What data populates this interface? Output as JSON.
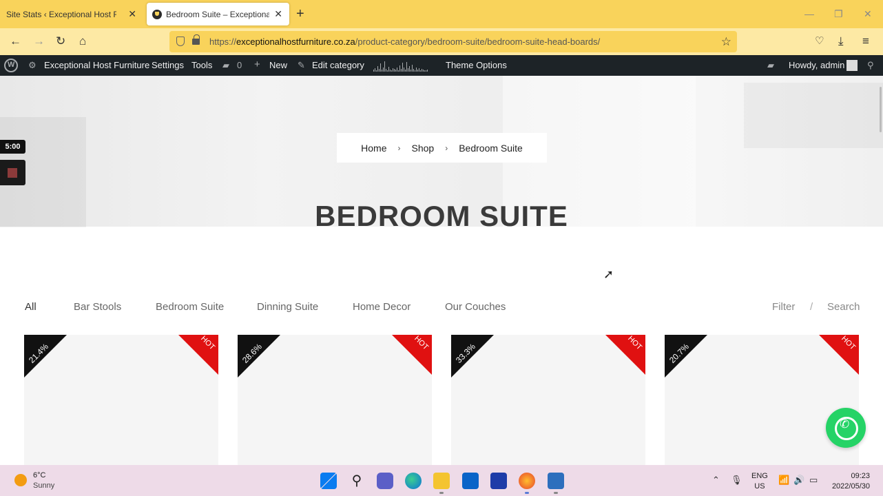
{
  "browser": {
    "tabs": [
      {
        "title": "Site Stats ‹ Exceptional Host Furniture",
        "active": false
      },
      {
        "title": "Bedroom Suite – Exceptional Host Furniture",
        "active": true
      }
    ],
    "url_domain": "exceptionalhostfurniture.co.za",
    "url_prefix": "https://",
    "url_path": "/product-category/bedroom-suite/bedroom-suite-head-boards/"
  },
  "adminbar": {
    "site_name": "Exceptional Host Furniture",
    "settings": "Settings",
    "tools": "Tools",
    "comments_count": "0",
    "new": "New",
    "edit_category": "Edit category",
    "theme_options": "Theme Options",
    "howdy": "Howdy, admin"
  },
  "recorder": {
    "time": "5:00"
  },
  "hero": {
    "breadcrumb": [
      "Home",
      "Shop",
      "Bedroom Suite"
    ],
    "title": "BEDROOM SUITE"
  },
  "categories": [
    "All",
    "Bar Stools",
    "Bedroom Suite",
    "Dinning Suite",
    "Home Decor",
    "Our Couches"
  ],
  "filter_label": "Filter",
  "filter_sep": "/",
  "search_label": "Search",
  "products": [
    {
      "discount": "21.4%",
      "badge": "HOT"
    },
    {
      "discount": "28.6%",
      "badge": "HOT"
    },
    {
      "discount": "33.3%",
      "badge": "HOT"
    },
    {
      "discount": "20.7%",
      "badge": "HOT"
    }
  ],
  "taskbar": {
    "temp": "6°C",
    "weather": "Sunny",
    "lang1": "ENG",
    "lang2": "US",
    "time": "09:23",
    "date": "2022/05/30"
  },
  "colors": {
    "tab_bar": "#f9d35b",
    "admin_bar": "#1d2327",
    "hot": "#e01111",
    "whatsapp": "#25d366"
  }
}
